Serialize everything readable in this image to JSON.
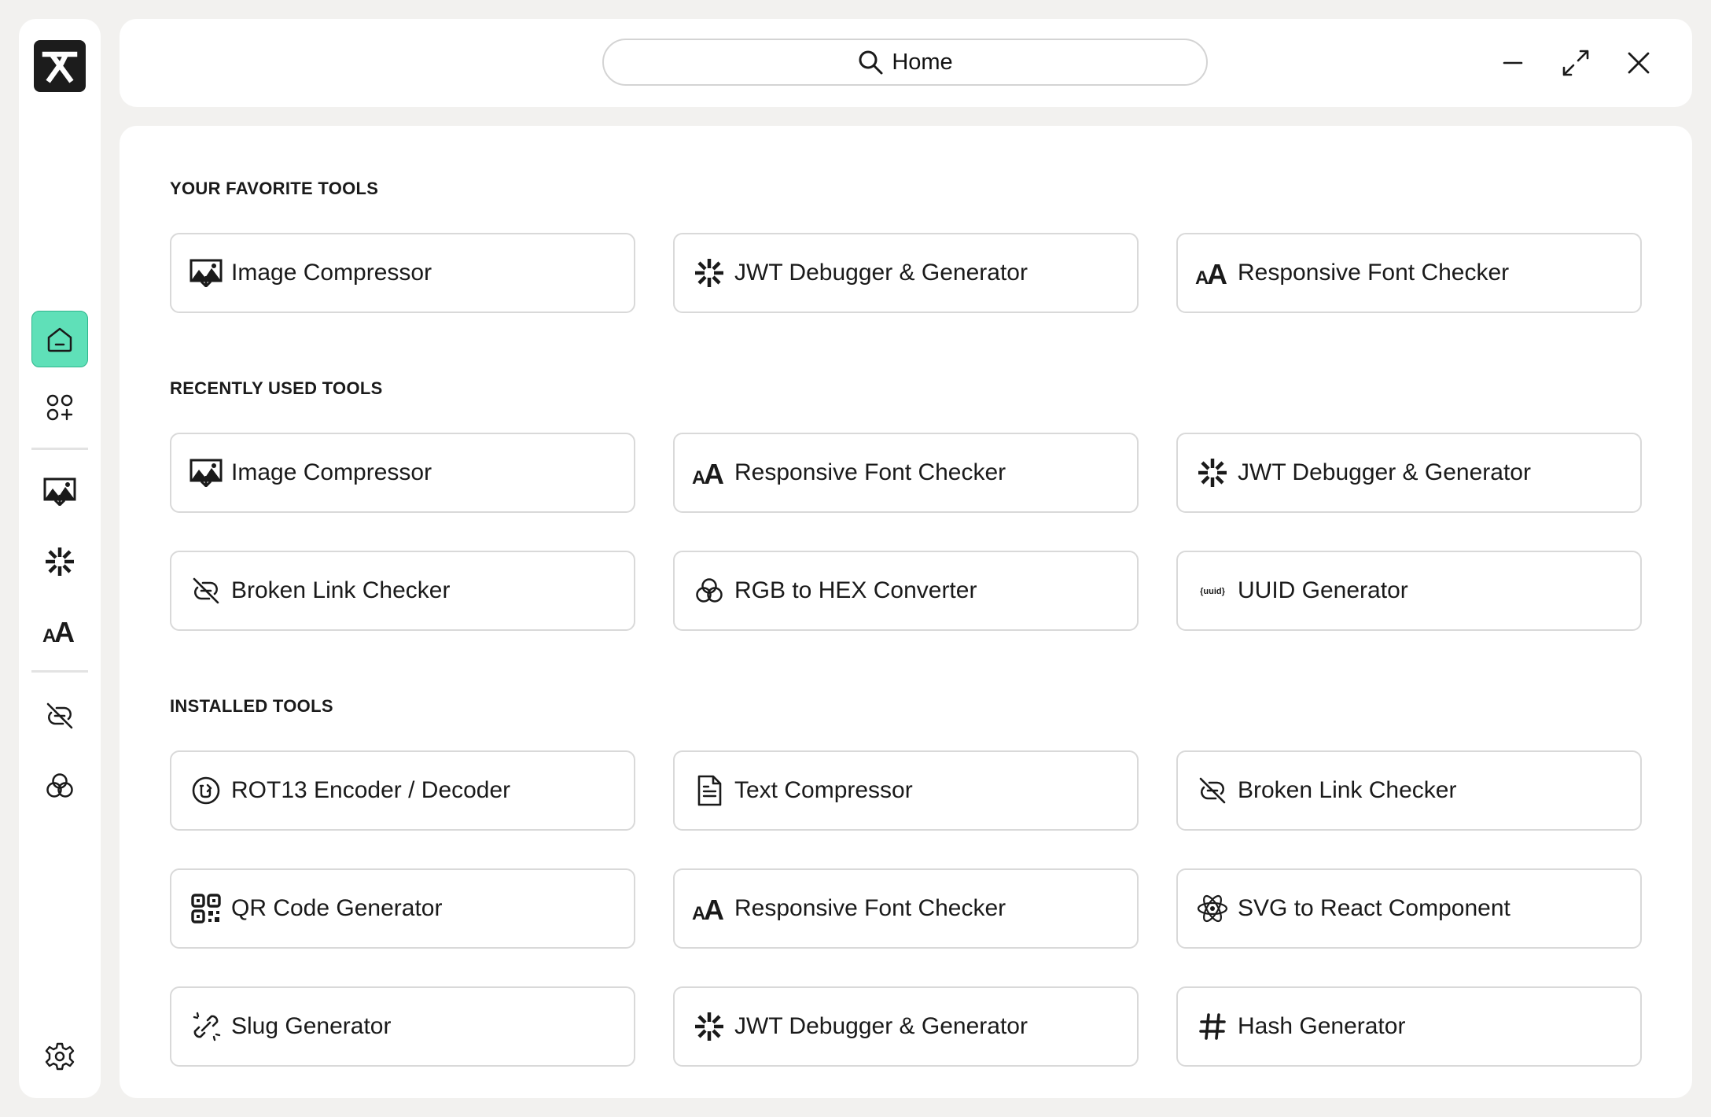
{
  "search": {
    "label": "Home"
  },
  "sections": {
    "favorites": {
      "title": "YOUR FAVORITE TOOLS",
      "items": [
        {
          "label": "Image Compressor",
          "icon": "image-icon"
        },
        {
          "label": "JWT Debugger & Generator",
          "icon": "jwt-icon"
        },
        {
          "label": "Responsive Font Checker",
          "icon": "font-icon"
        }
      ]
    },
    "recent": {
      "title": "RECENTLY USED TOOLS",
      "items": [
        {
          "label": "Image Compressor",
          "icon": "image-icon"
        },
        {
          "label": "Responsive Font Checker",
          "icon": "font-icon"
        },
        {
          "label": "JWT Debugger & Generator",
          "icon": "jwt-icon"
        },
        {
          "label": "Broken Link Checker",
          "icon": "broken-link-icon"
        },
        {
          "label": "RGB to HEX Converter",
          "icon": "rgb-icon"
        },
        {
          "label": "UUID Generator",
          "icon": "uuid-icon",
          "icon_text": "{uuid}"
        }
      ]
    },
    "installed": {
      "title": "INSTALLED TOOLS",
      "items": [
        {
          "label": "ROT13 Encoder / Decoder",
          "icon": "rot13-icon"
        },
        {
          "label": "Text Compressor",
          "icon": "document-icon"
        },
        {
          "label": "Broken Link Checker",
          "icon": "broken-link-icon"
        },
        {
          "label": "QR Code Generator",
          "icon": "qr-code-icon"
        },
        {
          "label": "Responsive Font Checker",
          "icon": "font-icon"
        },
        {
          "label": "SVG to React Component",
          "icon": "react-icon"
        },
        {
          "label": "Slug Generator",
          "icon": "slug-icon"
        },
        {
          "label": "JWT Debugger & Generator",
          "icon": "jwt-icon"
        },
        {
          "label": "Hash Generator",
          "icon": "hash-icon"
        }
      ]
    }
  },
  "sidebar": {
    "items": [
      {
        "name": "home",
        "icon": "home-icon",
        "active": true
      },
      {
        "name": "add-tools",
        "icon": "apps-add-icon"
      },
      {
        "name": "image-compressor",
        "icon": "image-icon"
      },
      {
        "name": "jwt-debugger",
        "icon": "jwt-icon"
      },
      {
        "name": "font-checker",
        "icon": "font-icon"
      },
      {
        "name": "broken-link-checker",
        "icon": "broken-link-icon"
      },
      {
        "name": "rgb-to-hex",
        "icon": "rgb-icon"
      },
      {
        "name": "settings",
        "icon": "gear-icon"
      }
    ]
  },
  "colors": {
    "accent": "#5fe0b8",
    "accent_border": "#2fb58c",
    "background": "#f2f1ef"
  }
}
